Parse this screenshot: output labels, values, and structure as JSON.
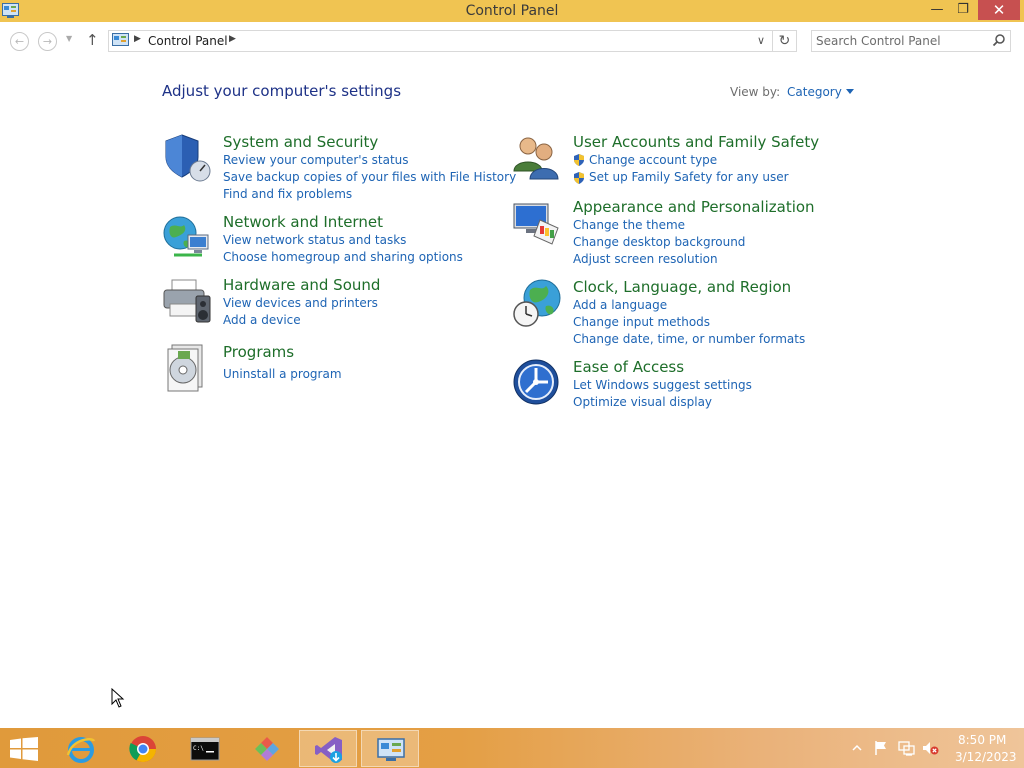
{
  "window": {
    "title": "Control Panel",
    "minimize_glyph": "—",
    "restore_glyph": "❐",
    "close_glyph": "✕"
  },
  "address_bar": {
    "back_glyph": "←",
    "forward_glyph": "→",
    "recent_glyph": "▼",
    "up_glyph": "↑",
    "separator_glyph": "▶",
    "breadcrumb": "Control Panel",
    "dropdown_glyph": "∨",
    "refresh_glyph": "↻",
    "search_placeholder": "Search Control Panel"
  },
  "content": {
    "heading": "Adjust your computer's settings",
    "view_by_label": "View by:",
    "view_by_value": "Category"
  },
  "categories": [
    {
      "title": "System and Security",
      "icon": "shield-icon",
      "links": [
        "Review your computer's status",
        "Save backup copies of your files with File History",
        "Find and fix problems"
      ]
    },
    {
      "title": "Network and Internet",
      "icon": "network-globe-icon",
      "links": [
        "View network status and tasks",
        "Choose homegroup and sharing options"
      ]
    },
    {
      "title": "Hardware and Sound",
      "icon": "printer-speaker-icon",
      "links": [
        "View devices and printers",
        "Add a device"
      ]
    },
    {
      "title": "Programs",
      "icon": "programs-disc-icon",
      "links": [
        "Uninstall a program"
      ]
    },
    {
      "title": "User Accounts and Family Safety",
      "icon": "users-icon",
      "links": [
        "Change account type",
        "Set up Family Safety for any user"
      ]
    },
    {
      "title": "Appearance and Personalization",
      "icon": "monitor-palette-icon",
      "links": [
        "Change the theme",
        "Change desktop background",
        "Adjust screen resolution"
      ]
    },
    {
      "title": "Clock, Language, and Region",
      "icon": "clock-globe-icon",
      "links": [
        "Add a language",
        "Change input methods",
        "Change date, time, or number formats"
      ]
    },
    {
      "title": "Ease of Access",
      "icon": "ease-of-access-icon",
      "links": [
        "Let Windows suggest settings",
        "Optimize visual display"
      ]
    }
  ],
  "taskbar": {
    "items": [
      "internet-explorer-icon",
      "chrome-icon",
      "command-prompt-icon",
      "paint-icon",
      "visual-studio-installer-icon",
      "control-panel-icon"
    ],
    "tray": [
      "show-hidden-icons-icon",
      "action-center-flag-icon",
      "network-icon",
      "volume-muted-icon"
    ],
    "time": "8:50 PM",
    "date": "3/12/2023"
  },
  "colors": {
    "titlebar": "#f0c452",
    "heading": "#1e3287",
    "category_title": "#1e6e2a",
    "link": "#1e64b4",
    "taskbar": "#e49f45"
  }
}
